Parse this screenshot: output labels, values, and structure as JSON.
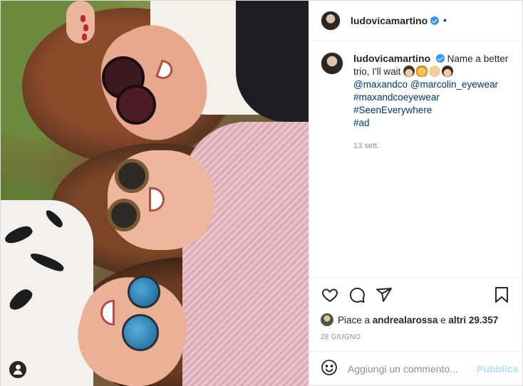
{
  "header": {
    "username": "ludovicamartino",
    "separator": "•"
  },
  "caption": {
    "username": "ludovicamartino",
    "text": "Name a better trio, I'll wait",
    "mentions": [
      "@maxandco",
      "@marcolin_eyewear"
    ],
    "hashtags": [
      "#maxandcoeyewear",
      "#SeenEverywhere",
      "#ad"
    ],
    "time": "13 sett."
  },
  "likes": {
    "prefix": "Piace a ",
    "user": "andrealarossa",
    "middle": " e ",
    "others": "altri 29.357"
  },
  "date": "28 GIUGNO",
  "comment": {
    "placeholder": "Aggiungi un commento...",
    "publish_label": "Pubblica"
  },
  "colors": {
    "verified": "#3897f0",
    "link": "#00376b",
    "publish_disabled": "#b2dffc"
  },
  "icons": [
    "heart-icon",
    "comment-icon",
    "share-icon",
    "bookmark-icon",
    "emoji-icon",
    "user-tag-icon",
    "verified-icon"
  ]
}
